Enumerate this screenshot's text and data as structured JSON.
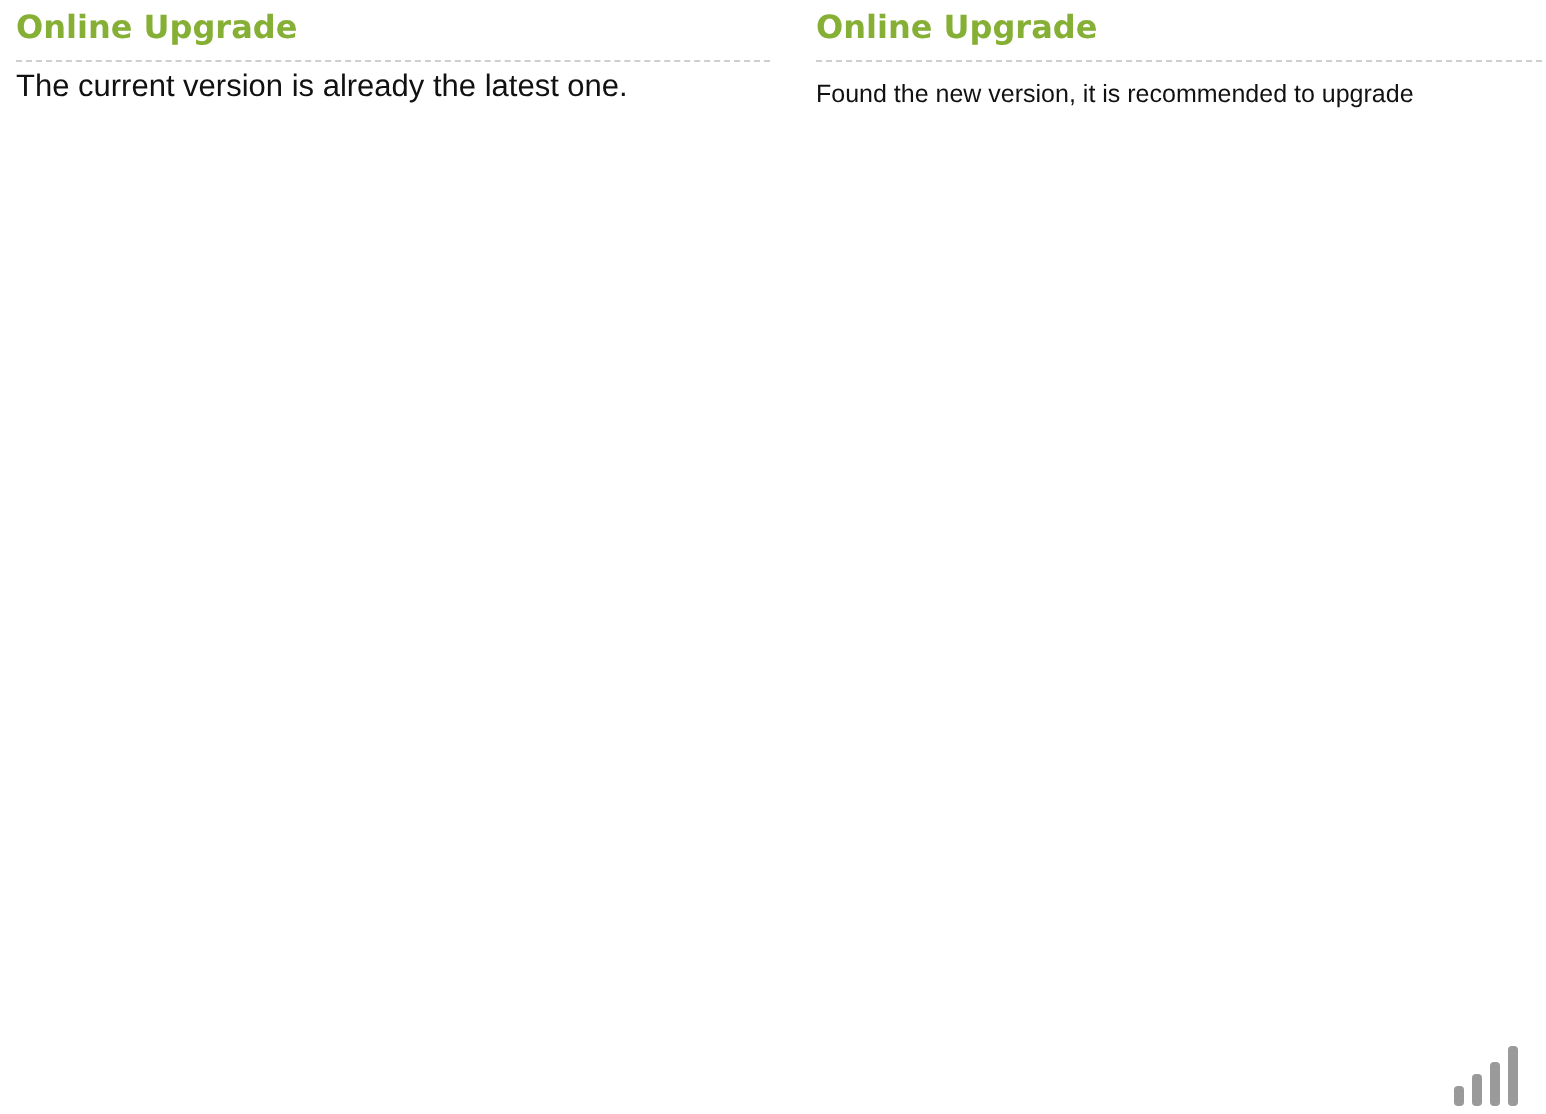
{
  "panels": [
    {
      "title": "Online Upgrade",
      "message": "The current version is already the latest one.",
      "kind": "large"
    },
    {
      "title": "Online Upgrade",
      "message": "Found the new version, it is recommended to upgrade",
      "kind": "small"
    }
  ]
}
